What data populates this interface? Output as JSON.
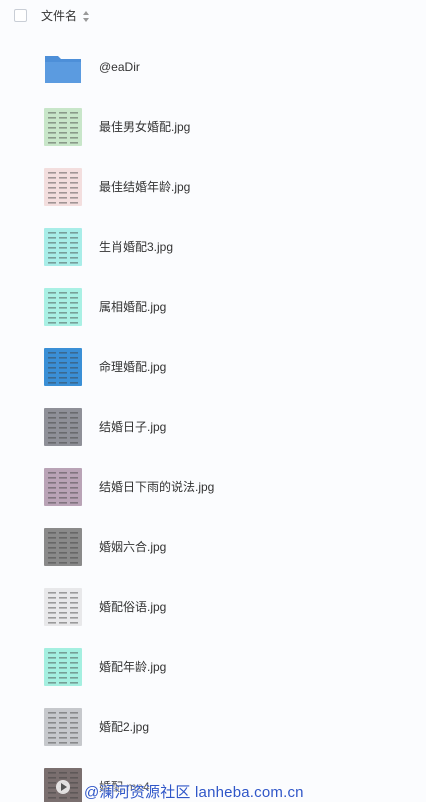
{
  "header": {
    "column_label": "文件名",
    "sort_icon": "sort-up-down-icon"
  },
  "files": [
    {
      "name": "@eaDir",
      "icon": "folder-icon",
      "tint": "#5b9be0"
    },
    {
      "name": "最佳男女婚配.jpg",
      "icon": "image-thumbnail",
      "tint": "#c8e6c9"
    },
    {
      "name": "最佳结婚年龄.jpg",
      "icon": "image-thumbnail",
      "tint": "#f3dede"
    },
    {
      "name": "生肖婚配3.jpg",
      "icon": "image-thumbnail",
      "tint": "#a8ede8"
    },
    {
      "name": "属相婚配.jpg",
      "icon": "image-thumbnail",
      "tint": "#a9f0e4"
    },
    {
      "name": "命理婚配.jpg",
      "icon": "image-thumbnail",
      "tint": "#3a8fd6"
    },
    {
      "name": "结婚日子.jpg",
      "icon": "image-thumbnail",
      "tint": "#8f9098"
    },
    {
      "name": "结婚日下雨的说法.jpg",
      "icon": "image-thumbnail",
      "tint": "#b9a3b6"
    },
    {
      "name": "婚姻六合.jpg",
      "icon": "image-thumbnail",
      "tint": "#8a8a8a"
    },
    {
      "name": "婚配俗语.jpg",
      "icon": "image-thumbnail",
      "tint": "#e8e8ea"
    },
    {
      "name": "婚配年龄.jpg",
      "icon": "image-thumbnail",
      "tint": "#a4efe0"
    },
    {
      "name": "婚配2.jpg",
      "icon": "image-thumbnail",
      "tint": "#c6c8cc"
    },
    {
      "name": "婚配.mp4",
      "icon": "video-thumbnail",
      "tint": "#7a6f6f"
    }
  ],
  "watermark": "@澜河资源社区 lanheba.com.cn"
}
